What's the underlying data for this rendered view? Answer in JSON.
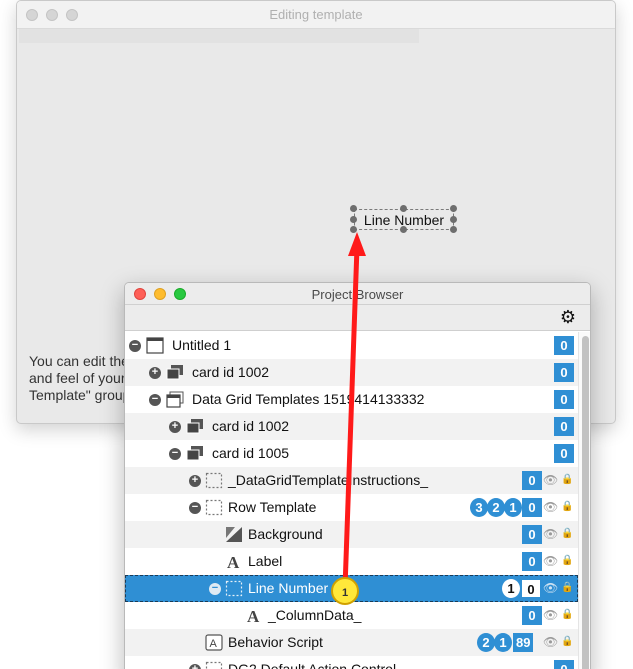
{
  "back_window": {
    "title": "Editing template",
    "body_text": "You can edit the and feel of your Template\" group",
    "field_label": "Line Number"
  },
  "project_browser": {
    "title": "Project Browser",
    "settings_icon": "gear-icon",
    "rows": [
      {
        "label": "Untitled 1",
        "icon": "stack-window-icon",
        "expander": "minus",
        "counts": [
          "0"
        ]
      },
      {
        "label": "card id 1002",
        "icon": "card-icon",
        "expander": "plus",
        "counts": [
          "0"
        ]
      },
      {
        "label": "Data Grid Templates 1519414133332",
        "icon": "stack-window-icon",
        "expander": "minus",
        "counts": [
          "0"
        ]
      },
      {
        "label": "card id 1002",
        "icon": "card-icon",
        "expander": "plus",
        "counts": [
          "0"
        ]
      },
      {
        "label": "card id 1005",
        "icon": "card-icon",
        "expander": "minus",
        "counts": [
          "0"
        ]
      },
      {
        "label": "_DataGridTemplateInstructions_",
        "icon": "group-icon",
        "expander": "plus",
        "counts": [
          "0"
        ]
      },
      {
        "label": "Row Template",
        "icon": "group-icon",
        "expander": "minus",
        "badges": [
          "3",
          "2",
          "1"
        ],
        "counts": [
          "0"
        ]
      },
      {
        "label": "Background",
        "icon": "graphic-icon",
        "counts": [
          "0"
        ]
      },
      {
        "label": "Label",
        "icon": "text-field-icon",
        "counts": [
          "0"
        ]
      },
      {
        "label": "Line Number",
        "icon": "group-icon",
        "expander": "minus",
        "badges": [
          "1"
        ],
        "counts": [
          "0"
        ],
        "selected": true
      },
      {
        "label": "_ColumnData_",
        "icon": "text-field-icon",
        "counts": [
          "0"
        ]
      },
      {
        "label": "Behavior Script",
        "icon": "button-icon",
        "badges": [
          "2",
          "1"
        ],
        "counts": [
          "89"
        ]
      },
      {
        "label": "DG2 Default Action Control",
        "icon": "group-icon",
        "expander": "plus",
        "counts": [
          "0"
        ]
      }
    ]
  },
  "annotation": {
    "marker": "1",
    "arrow_color": "#ff0000",
    "marker_color": "#ffe83a"
  },
  "colors": {
    "accent": "#2f8fd4",
    "selection": "#2f8fd4"
  }
}
